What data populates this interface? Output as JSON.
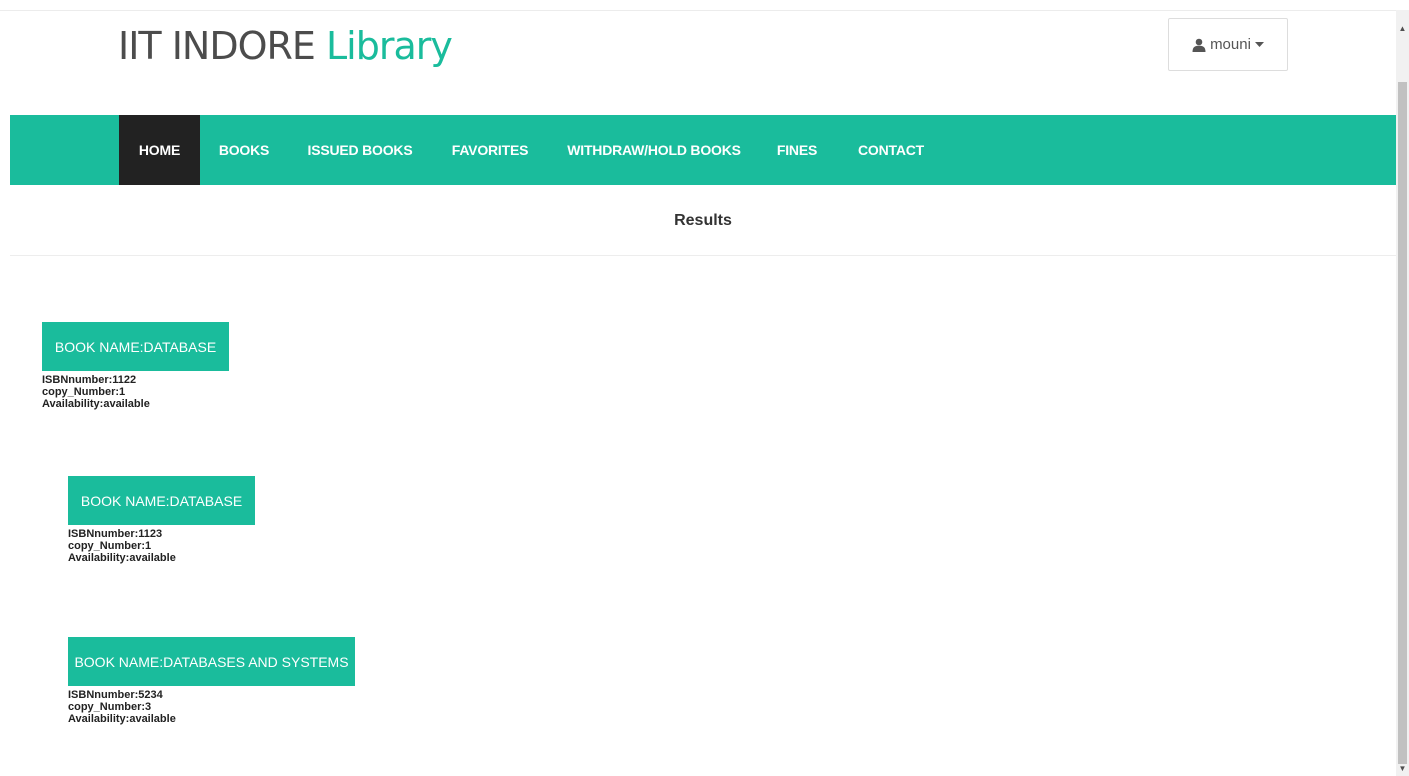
{
  "header": {
    "brand_part1": "IIT INDORE",
    "brand_part2": "Library",
    "user_name": "mouni"
  },
  "nav": {
    "items": [
      {
        "label": "HOME",
        "active": true
      },
      {
        "label": "BOOKS",
        "active": false
      },
      {
        "label": "ISSUED BOOKS",
        "active": false
      },
      {
        "label": "FAVORITES",
        "active": false
      },
      {
        "label": "WITHDRAW/HOLD BOOKS",
        "active": false
      },
      {
        "label": "FINES",
        "active": false
      },
      {
        "label": "CONTACT",
        "active": false
      }
    ]
  },
  "results": {
    "title": "Results",
    "books": [
      {
        "name_label": "BOOK NAME:DATABASE",
        "isbn": "ISBNnumber:1122",
        "copy": "copy_Number:1",
        "availability": "Availability:available"
      },
      {
        "name_label": "BOOK NAME:DATABASE",
        "isbn": "ISBNnumber:1123",
        "copy": "copy_Number:1",
        "availability": "Availability:available"
      },
      {
        "name_label": "BOOK NAME:DATABASES AND SYSTEMS",
        "isbn": "ISBNnumber:5234",
        "copy": "copy_Number:3",
        "availability": "Availability:available"
      }
    ]
  },
  "colors": {
    "accent": "#1abc9c",
    "nav_active": "#222222"
  },
  "icons": {
    "user": "user-icon",
    "caret": "caret-down-icon",
    "scroll_up": "scroll-up-arrow-icon",
    "scroll_down": "scroll-down-arrow-icon"
  }
}
